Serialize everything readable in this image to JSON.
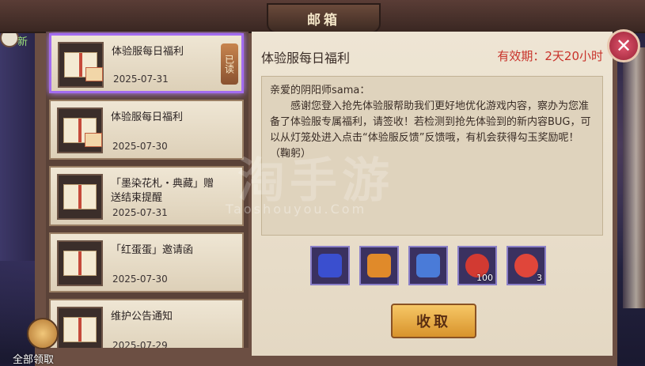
{
  "window": {
    "title": "邮箱"
  },
  "side": {
    "new_label": "新"
  },
  "mail_list": [
    {
      "title": "体验服每日福利",
      "date": "2025-07-31",
      "read_label": "已读",
      "selected": true,
      "gift": true
    },
    {
      "title": "体验服每日福利",
      "date": "2025-07-30",
      "gift": true
    },
    {
      "title": "「墨染花札・典藏」赠送结束提醒",
      "date": "2025-07-31"
    },
    {
      "title": "「红蛋蛋」邀请函",
      "date": "2025-07-30"
    },
    {
      "title": "维护公告通知",
      "date": "2025-07-29"
    }
  ],
  "detail": {
    "title": "体验服每日福利",
    "validity": "有效期：2天20小时",
    "greeting": "亲爱的阴阳师sama：",
    "body": "感谢您登入抢先体验服帮助我们更好地优化游戏内容，察办为您准备了体验服专属福利，请签收！若检测到抢先体验到的新内容BUG，可以从灯笼处进入点击“体验服反馈”反馈哦，有机会获得勾玉奖励呢！（鞠躬）"
  },
  "attachments": [
    {
      "name": "blue-amulet-icon",
      "qty": "",
      "color": "#3a4fcf"
    },
    {
      "name": "gold-amulet-icon",
      "qty": "",
      "color": "#e08a2a"
    },
    {
      "name": "card-pack-icon",
      "qty": "",
      "color": "#4a7bd8"
    },
    {
      "name": "red-daruma-fish-icon",
      "qty": "100",
      "color": "#d23a32"
    },
    {
      "name": "red-daruma-icon",
      "qty": "3",
      "color": "#e0463a"
    }
  ],
  "actions": {
    "collect_label": "收取",
    "collect_all_label": "全部领取"
  },
  "watermark": {
    "main": "淘手游",
    "sub": "Taoshouyou.Com"
  }
}
